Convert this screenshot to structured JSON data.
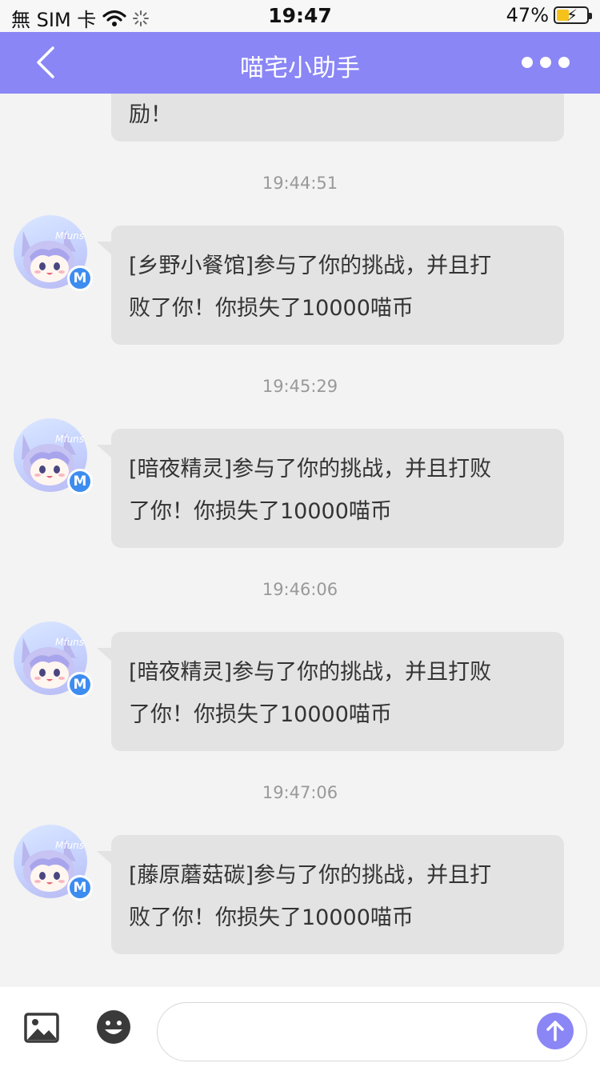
{
  "status_bar": {
    "carrier": "無 SIM 卡",
    "time": "19:47",
    "battery_percent": "47%",
    "battery_level": 0.47
  },
  "nav": {
    "title": "喵宅小助手"
  },
  "chat": {
    "partial_message": "励！",
    "messages": [
      {
        "timestamp": "19:44:51",
        "line1": "[乡野小餐馆]参与了你的挑战，并且打",
        "line2": "败了你！你损失了10000喵币"
      },
      {
        "timestamp": "19:45:29",
        "line1": "[暗夜精灵]参与了你的挑战，并且打败",
        "line2": "了你！你损失了10000喵币"
      },
      {
        "timestamp": "19:46:06",
        "line1": "[暗夜精灵]参与了你的挑战，并且打败",
        "line2": "了你！你损失了10000喵币"
      },
      {
        "timestamp": "19:47:06",
        "line1": "[藤原蘑菇碳]参与了你的挑战，并且打",
        "line2": "败了你！你损失了10000喵币"
      }
    ],
    "avatar_text": "Mfuns",
    "badge_letter": "M"
  },
  "input_bar": {
    "icons": [
      "image-icon",
      "emoji-icon",
      "arrow-up-icon"
    ],
    "input_value": ""
  },
  "colors": {
    "accent": "#8a86f5",
    "bubble": "#e3e3e3",
    "badge": "#3d8cf0"
  }
}
